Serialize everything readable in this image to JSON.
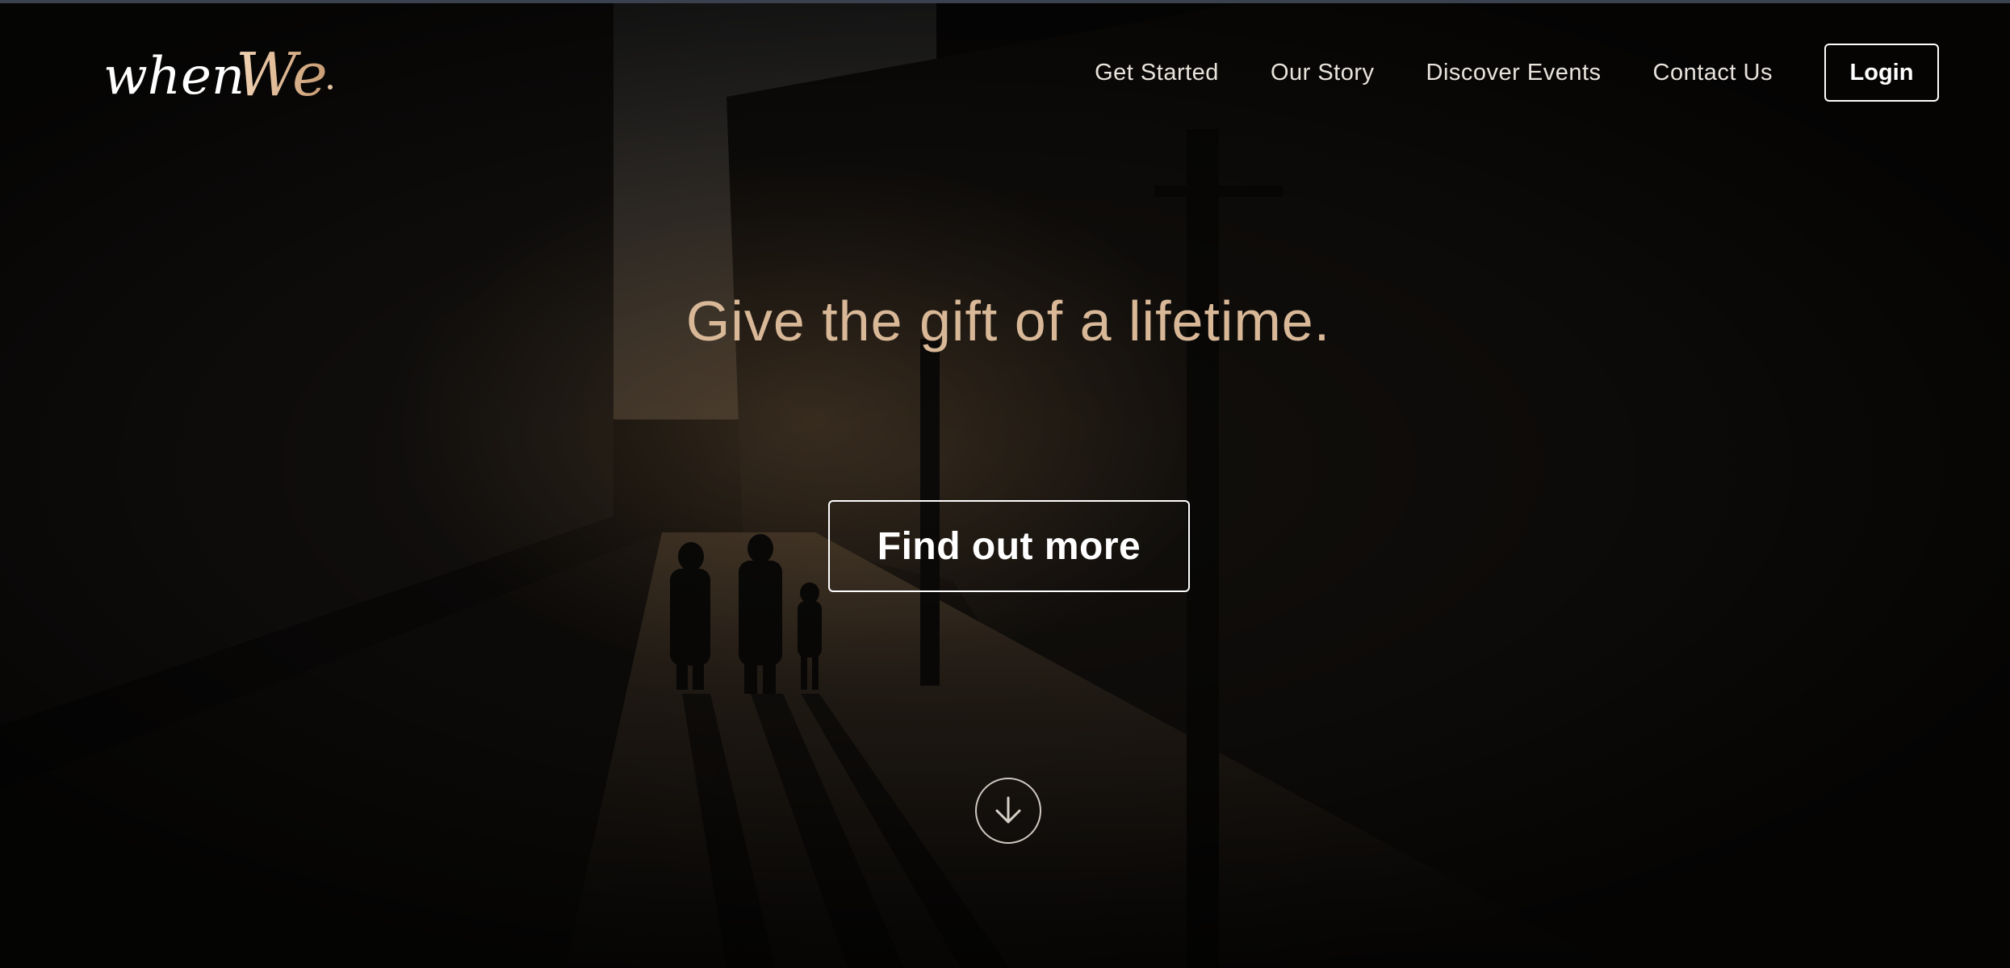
{
  "brand": {
    "logo_text": "whenWe.",
    "accent_color": "#d9b898"
  },
  "nav": {
    "links": [
      "Get Started",
      "Our Story",
      "Discover Events",
      "Contact Us"
    ],
    "login_label": "Login"
  },
  "hero": {
    "headline": "Give the gift of a lifetime.",
    "cta_label": "Find out more",
    "scroll_icon": "arrow-down-circle-icon"
  }
}
